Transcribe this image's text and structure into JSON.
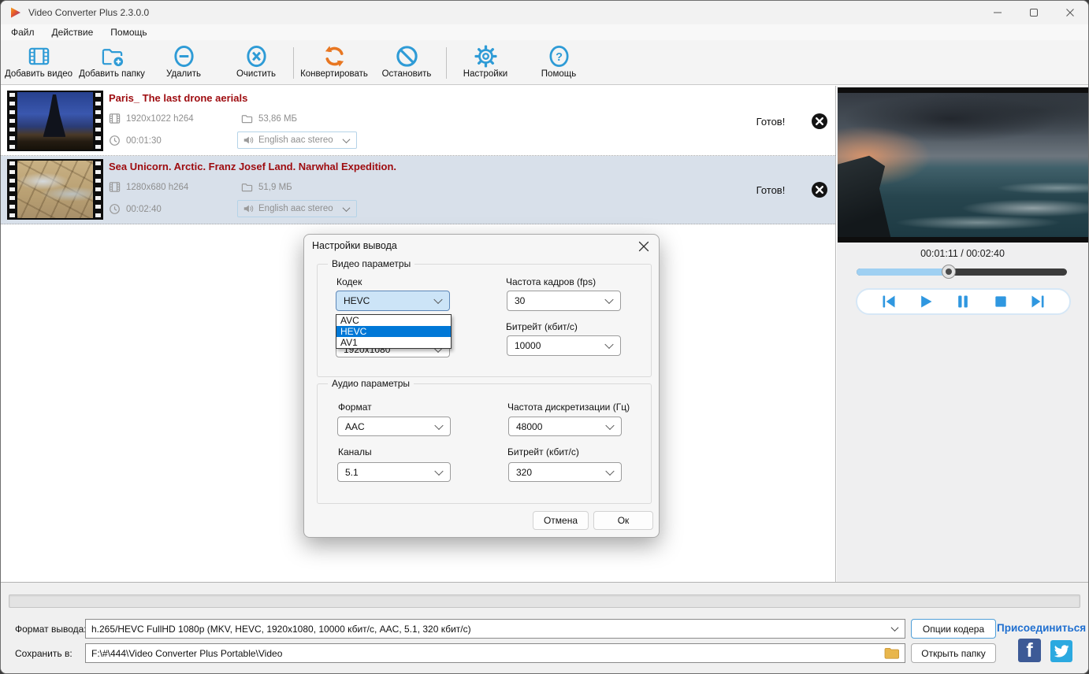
{
  "window": {
    "title": "Video Converter Plus 2.3.0.0"
  },
  "menu": {
    "items": [
      {
        "label": "Файл"
      },
      {
        "label": "Действие"
      },
      {
        "label": "Помощь"
      }
    ]
  },
  "toolbar": {
    "buttons": [
      {
        "label": "Добавить видео",
        "icon": "add-video-icon"
      },
      {
        "label": "Добавить папку",
        "icon": "add-folder-icon"
      },
      {
        "label": "Удалить",
        "icon": "remove-icon"
      },
      {
        "label": "Очистить",
        "icon": "clear-icon"
      },
      {
        "label": "Конвертировать",
        "icon": "convert-icon"
      },
      {
        "label": "Остановить",
        "icon": "stop-icon"
      },
      {
        "label": "Настройки",
        "icon": "settings-gear-icon"
      },
      {
        "label": "Помощь",
        "icon": "help-icon"
      }
    ]
  },
  "video_list": {
    "items": [
      {
        "title": "Paris_ The last drone aerials",
        "resolution": "1920x1022 h264",
        "size": "53,86 МБ",
        "duration": "00:01:30",
        "audio": "English aac stereo",
        "status": "Готов!",
        "selected": false
      },
      {
        "title": "Sea Unicorn. Arctic. Franz Josef Land. Narwhal Expedition.",
        "resolution": "1280x680 h264",
        "size": "51,9 МБ",
        "duration": "00:02:40",
        "audio": "English aac stereo",
        "status": "Готов!",
        "selected": true
      }
    ]
  },
  "player": {
    "time": "00:01:11 / 00:02:40",
    "progress_percent": 44
  },
  "dialog": {
    "title": "Настройки вывода",
    "video_group": {
      "label": "Видео параметры",
      "codec_label": "Кодек",
      "codec_value": "HEVC",
      "codec_options": [
        "AVC",
        "HEVC",
        "AV1"
      ],
      "codec_selected": "HEVC",
      "resolution_value": "1920x1080",
      "fps_label": "Частота кадров (fps)",
      "fps_value": "30",
      "bitrate_label": "Битрейт (кбит/с)",
      "bitrate_value": "10000"
    },
    "audio_group": {
      "label": "Аудио параметры",
      "format_label": "Формат",
      "format_value": "AAC",
      "samplerate_label": "Частота дискретизации (Гц)",
      "samplerate_value": "48000",
      "channels_label": "Каналы",
      "channels_value": "5.1",
      "bitrate_label": "Битрейт (кбит/с)",
      "bitrate_value": "320"
    },
    "cancel_label": "Отмена",
    "ok_label": "Ок"
  },
  "bottom": {
    "format_label": "Формат вывода:",
    "format_value": "h.265/HEVC FullHD 1080p (MKV, HEVC, 1920x1080, 10000 кбит/с, AAC, 5.1, 320 кбит/с)",
    "save_label": "Сохранить в:",
    "save_value": "F:\\#\\444\\Video Converter Plus Portable\\Video",
    "encoder_options_label": "Опции кодера",
    "open_folder_label": "Открыть папку",
    "join_label": "Присоединиться"
  },
  "colors": {
    "accent_blue": "#2e9bd6",
    "convert_orange": "#e87722",
    "selection": "#d8e0ea",
    "row_title_red": "#9e0b0f",
    "dropdown_highlight": "#0078d7",
    "join_link": "#1f6fd0",
    "facebook": "#3d5a96",
    "twitter": "#2ba9e0"
  }
}
